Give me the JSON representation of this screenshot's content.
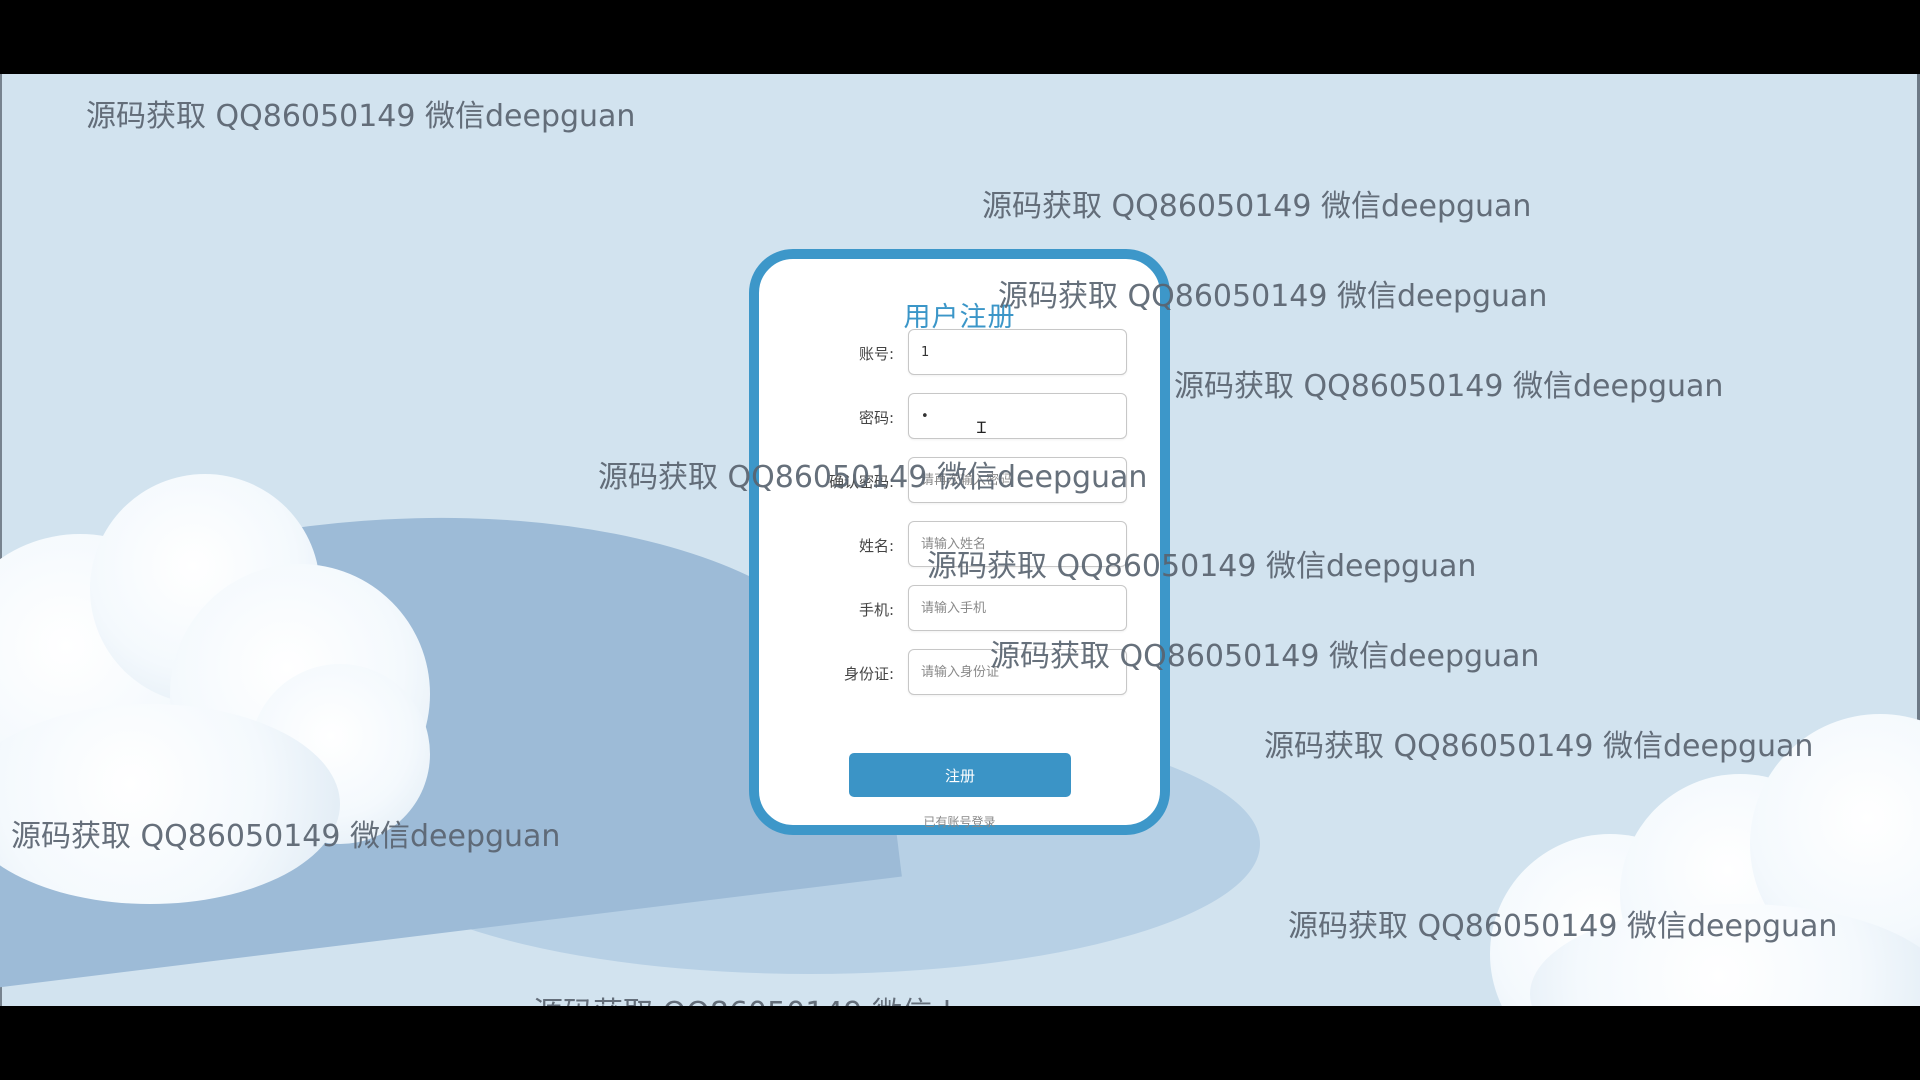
{
  "form": {
    "title": "用户注册",
    "fields": [
      {
        "label": "账号:",
        "value": "1",
        "placeholder": ""
      },
      {
        "label": "密码:",
        "value": "•",
        "placeholder": ""
      },
      {
        "label": "确认密码:",
        "value": "",
        "placeholder": "请再次输入密码"
      },
      {
        "label": "姓名:",
        "value": "",
        "placeholder": "请输入姓名"
      },
      {
        "label": "手机:",
        "value": "",
        "placeholder": "请输入手机"
      },
      {
        "label": "身份证:",
        "value": "",
        "placeholder": "请输入身份证"
      }
    ],
    "submit_label": "注册",
    "login_link": "已有账号登录"
  },
  "watermark_text": "源码获取 QQ86050149 微信deepguan",
  "colors": {
    "accent": "#3b94c6",
    "background": "#d2e3ef",
    "hill": "#9dbbd7"
  },
  "icons": {
    "text_cursor": "i-beam"
  }
}
